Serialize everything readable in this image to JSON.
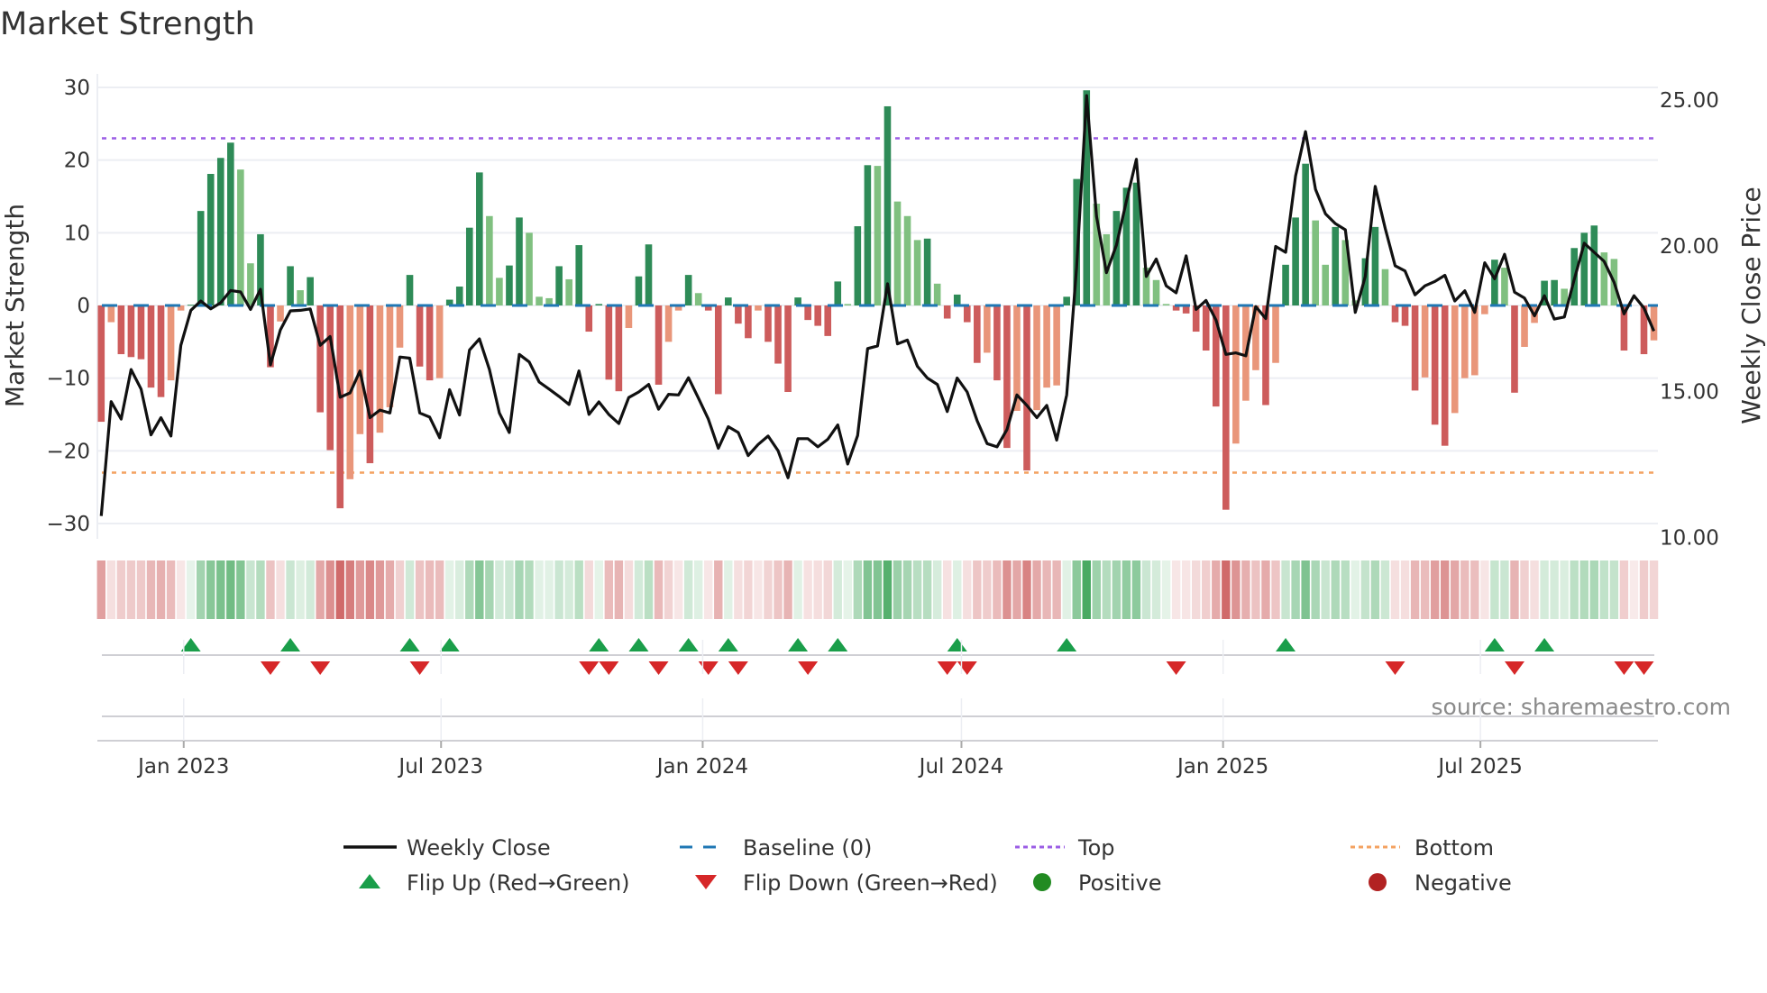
{
  "chart_data": {
    "type": "bar",
    "title": "Market Strength",
    "ylabel": "Market Strength",
    "y2label": "Weekly Close Price",
    "ylim": [
      -32,
      32
    ],
    "y2lim": [
      10,
      25
    ],
    "left_ticks": [
      30,
      20,
      10,
      0,
      -10,
      -20,
      -30
    ],
    "left_tick_labels": [
      "30",
      "20",
      "10",
      "0",
      "−10",
      "−20",
      "−30"
    ],
    "right_ticks": [
      25,
      20,
      15,
      10
    ],
    "right_tick_labels": [
      "25.00",
      "20.00",
      "15.00",
      "10.00"
    ],
    "x_ticks": [
      "2023-01-01",
      "2023-07-01",
      "2024-01-01",
      "2024-07-01",
      "2025-01-01",
      "2025-07-01"
    ],
    "x_tick_labels": [
      "Jan 2023",
      "Jul 2023",
      "Jan 2024",
      "Jul 2024",
      "Jan 2025",
      "Jul 2025"
    ],
    "start_date": "2022-11-04",
    "frequency": "weekly",
    "top_level": 23,
    "bottom_level": -23,
    "baseline": 0,
    "values": [
      -16.0,
      -2.3,
      -6.7,
      -7.1,
      -7.4,
      -11.3,
      -12.6,
      -10.3,
      -0.7,
      0.1,
      13.0,
      18.1,
      20.3,
      22.4,
      18.7,
      5.8,
      9.8,
      -8.5,
      -2.2,
      5.4,
      2.1,
      3.9,
      -14.7,
      -19.9,
      -27.9,
      -23.9,
      -17.7,
      -21.7,
      -17.5,
      -14.0,
      -5.8,
      4.2,
      -8.4,
      -10.3,
      -10.0,
      0.8,
      2.6,
      10.7,
      18.3,
      12.3,
      3.8,
      5.5,
      12.1,
      10.0,
      1.2,
      1.0,
      5.4,
      3.6,
      8.3,
      -3.6,
      0.2,
      -10.2,
      -11.8,
      -3.1,
      4.0,
      8.4,
      -10.9,
      -5.0,
      -0.7,
      4.2,
      1.7,
      -0.7,
      -12.2,
      1.1,
      -2.5,
      -4.5,
      -0.7,
      -5.0,
      -8.0,
      -11.9,
      1.1,
      -2.0,
      -2.8,
      -4.2,
      3.3,
      0.2,
      10.9,
      19.3,
      19.2,
      27.4,
      14.3,
      12.3,
      9.0,
      9.2,
      3.0,
      -1.8,
      1.5,
      -2.3,
      -7.9,
      -6.5,
      -10.3,
      -19.6,
      -14.5,
      -22.7,
      -14.4,
      -11.3,
      -11.0,
      1.2,
      17.4,
      29.6,
      14.0,
      9.8,
      13.0,
      16.2,
      16.9,
      5.2,
      3.5,
      0.2,
      -0.7,
      -1.1,
      -3.6,
      -6.2,
      -13.9,
      -28.1,
      -19.0,
      -13.1,
      -8.9,
      -13.7,
      -7.9,
      5.6,
      12.1,
      19.5,
      11.7,
      5.6,
      10.8,
      9.0,
      0.7,
      6.5,
      10.8,
      5.0,
      -2.3,
      -2.8,
      -11.7,
      -9.9,
      -16.4,
      -19.3,
      -14.8,
      -10.0,
      -9.6,
      -1.2,
      6.3,
      5.2,
      -12.0,
      -5.7,
      -2.4,
      3.4,
      3.5,
      2.3,
      7.9,
      10.0,
      11.0,
      7.3,
      6.4,
      -6.2,
      0.0,
      -6.7,
      -4.8
    ],
    "close": [
      10.74,
      14.66,
      14.06,
      15.76,
      15.09,
      13.52,
      14.11,
      13.48,
      16.59,
      17.79,
      18.11,
      17.84,
      18.05,
      18.47,
      18.42,
      17.82,
      18.51,
      15.92,
      17.12,
      17.77,
      17.79,
      17.84,
      16.59,
      16.89,
      14.81,
      14.96,
      15.71,
      14.11,
      14.37,
      14.27,
      16.19,
      16.15,
      14.27,
      14.13,
      13.42,
      15.07,
      14.2,
      16.43,
      16.81,
      15.76,
      14.27,
      13.6,
      16.28,
      16.02,
      15.33,
      15.09,
      14.84,
      14.56,
      15.71,
      14.22,
      14.65,
      14.22,
      13.91,
      14.8,
      14.99,
      15.25,
      14.4,
      14.91,
      14.89,
      15.48,
      14.78,
      14.06,
      13.06,
      13.8,
      13.6,
      12.81,
      13.19,
      13.48,
      12.98,
      12.05,
      13.39,
      13.39,
      13.11,
      13.37,
      13.86,
      12.52,
      13.5,
      16.48,
      16.57,
      18.7,
      16.64,
      16.77,
      15.87,
      15.47,
      15.25,
      14.32,
      15.47,
      14.99,
      14.01,
      13.22,
      13.11,
      13.7,
      14.89,
      14.53,
      14.11,
      14.53,
      13.34,
      14.89,
      19.26,
      25.15,
      21.01,
      19.08,
      20.03,
      21.53,
      22.97,
      18.95,
      19.55,
      18.63,
      18.39,
      19.66,
      17.82,
      18.13,
      17.46,
      16.28,
      16.33,
      16.23,
      17.92,
      17.51,
      19.98,
      19.78,
      22.4,
      23.92,
      21.94,
      21.1,
      20.76,
      20.55,
      17.72,
      18.95,
      22.04,
      20.6,
      19.32,
      19.14,
      18.32,
      18.63,
      18.78,
      18.99,
      18.11,
      18.46,
      17.72,
      19.42,
      18.87,
      19.71,
      18.41,
      18.21,
      17.6,
      18.29,
      17.49,
      17.56,
      18.85,
      20.09,
      19.78,
      19.47,
      18.75,
      17.67,
      18.29,
      17.87,
      17.08
    ],
    "legend": [
      {
        "label": "Weekly Close",
        "kind": "line"
      },
      {
        "label": "Baseline (0)",
        "kind": "dash"
      },
      {
        "label": "Top",
        "kind": "dot-top"
      },
      {
        "label": "Bottom",
        "kind": "dot-bottom"
      },
      {
        "label": "Flip Up (Red→Green)",
        "kind": "tri-up"
      },
      {
        "label": "Flip Down (Green→Red)",
        "kind": "tri-down"
      },
      {
        "label": "Positive",
        "kind": "dot-pos"
      },
      {
        "label": "Negative",
        "kind": "dot-neg"
      }
    ],
    "legend_placement": "bottom",
    "source": "source: sharemaestro.com",
    "colors": {
      "pos_dark": "#2e8b57",
      "pos_light": "#80c080",
      "neg_dark": "#cd5c5c",
      "neg_light": "#e9967a",
      "close": "#111111",
      "baseline": "#1f77b4",
      "top": "#9b5de5",
      "bottom": "#f4a261",
      "flip_up": "#1a9e4a",
      "flip_down": "#d62728",
      "positive": "#228b22",
      "negative": "#b22222"
    }
  }
}
